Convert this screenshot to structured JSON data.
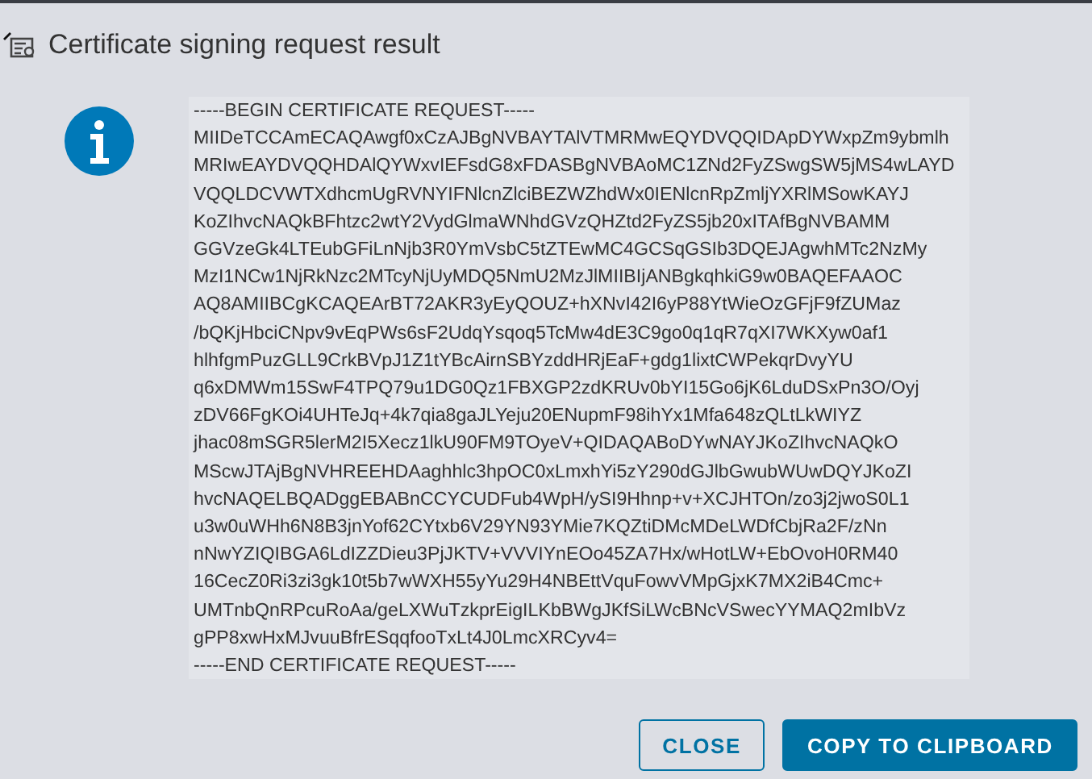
{
  "dialog": {
    "title": "Certificate signing request result"
  },
  "message": {
    "kind": "info",
    "lines": [
      "-----BEGIN CERTIFICATE REQUEST-----",
      "MIIDeTCCAmECAQAwgf0xCzAJBgNVBAYTAlVTMRMwEQYDVQQIDApDYWxpZm9ybmlh",
      "MRIwEAYDVQQHDAlQYWxvIEFsdG8xFDASBgNVBAoMC1ZNd2FyZSwgSW5jMS4wLAYD",
      "VQQLDCVWTXdhcmUgRVNYIFNlcnZlciBEZWZhdWx0IENlcnRpZmljYXRlMSowKAYJ",
      "KoZIhvcNAQkBFhtzc2wtY2VydGlmaWNhdGVzQHZtd2FyZS5jb20xITAfBgNVBAMM",
      "GGVzeGk4LTEubGFiLnNjb3R0YmVsbC5tZTEwMC4GCSqGSIb3DQEJAgwhMTc2NzMy",
      "MzI1NCw1NjRkNzc2MTcyNjUyMDQ5NmU2MzJlMIIBIjANBgkqhkiG9w0BAQEFAAOC",
      "AQ8AMIIBCgKCAQEArBT72AKR3yEyQOUZ+hXNvI42I6yP88YtWieOzGFjF9fZUMaz",
      "/bQKjHbciCNpv9vEqPWs6sF2UdqYsqoq5TcMw4dE3C9go0q1qR7qXI7WKXyw0af1",
      "hlhfgmPuzGLL9CrkBVpJ1Z1tYBcAirnSBYzddHRjEaF+gdg1lixtCWPekqrDvyYU",
      "q6xDMWm15SwF4TPQ79u1DG0Qz1FBXGP2zdKRUv0bYI15Go6jK6LduDSxPn3O/Oyj",
      "zDV66FgKOi4UHTeJq+4k7qia8gaJLYeju20ENupmF98ihYx1Mfa648zQLtLkWIYZ",
      "jhac08mSGR5lerM2I5Xecz1lkU90FM9TOyeV+QIDAQABoDYwNAYJKoZIhvcNAQkO",
      "MScwJTAjBgNVHREEHDAaghhlc3hpOC0xLmxhYi5zY290dGJlbGwubWUwDQYJKoZI",
      "hvcNAQELBQADggEBABnCCYCUDFub4WpH/ySI9Hhnp+v+XCJHTOn/zo3j2jwoS0L1",
      "u3w0uWHh6N8B3jnYof62CYtxb6V29YN93YMie7KQZtiDMcMDeLWDfCbjRa2F/zNn",
      "nNwYZIQIBGA6LdIZZDieu3PjJKTV+VVVIYnEOo45ZA7Hx/wHotLW+EbOvoH0RM40",
      "16CecZ0Ri3zi3gk10t5b7wWXH55yYu29H4NBEttVquFowvVMpGjxK7MX2iB4Cmc+",
      "UMTnbQnRPcuRoAa/geLXWuTzkprEigILKbBWgJKfSiLWcBNcVSwecYYMAQ2mIbVz",
      "gPP8xwHxMJvuuBfrESqqfooTxLt4J0LmcXRCyv4=",
      "-----END CERTIFICATE REQUEST-----"
    ]
  },
  "buttons": [
    {
      "label": "CLOSE",
      "kind": "secondary"
    },
    {
      "label": "COPY TO CLIPBOARD",
      "kind": "primary"
    }
  ]
}
